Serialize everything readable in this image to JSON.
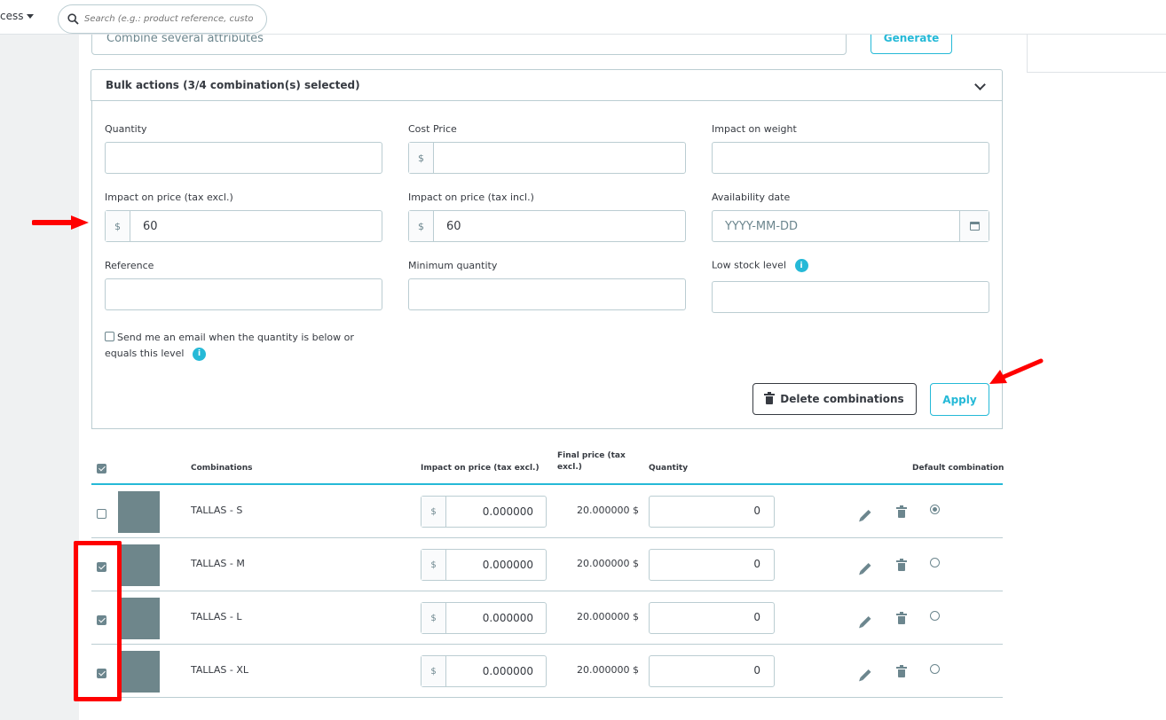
{
  "topbar": {
    "quick_access_label": "cess",
    "search_placeholder": "Search (e.g.: product reference, custon"
  },
  "generator": {
    "combine_placeholder": "Combine several attributes",
    "generate_label": "Generate"
  },
  "bulk": {
    "title": "Bulk actions (3/4 combination(s) selected)",
    "currency": "$",
    "fields": {
      "quantity_label": "Quantity",
      "cost_price_label": "Cost Price",
      "impact_weight_label": "Impact on weight",
      "impact_price_excl_label": "Impact on price (tax excl.)",
      "impact_price_excl_value": "60",
      "impact_price_incl_label": "Impact on price (tax incl.)",
      "impact_price_incl_value": "60",
      "availability_label": "Availability date",
      "availability_placeholder": "YYYY-MM-DD",
      "reference_label": "Reference",
      "min_qty_label": "Minimum quantity",
      "low_stock_label": "Low stock level"
    },
    "email_text_line1": "Send me an email when the quantity is below or",
    "email_text_line2": "equals this level",
    "info_glyph": "i",
    "delete_label": "Delete combinations",
    "apply_label": "Apply"
  },
  "table": {
    "headers": {
      "combinations": "Combinations",
      "impact": "Impact on price (tax excl.)",
      "final_line1": "Final price (tax",
      "final_line2": "excl.)",
      "quantity": "Quantity",
      "default": "Default combination"
    },
    "rows": [
      {
        "name": "TALLAS - S",
        "checked": false,
        "impact": "0.000000",
        "final": "20.000000 $",
        "quantity": "0",
        "default": true
      },
      {
        "name": "TALLAS - M",
        "checked": true,
        "impact": "0.000000",
        "final": "20.000000 $",
        "quantity": "0",
        "default": false
      },
      {
        "name": "TALLAS - L",
        "checked": true,
        "impact": "0.000000",
        "final": "20.000000 $",
        "quantity": "0",
        "default": false
      },
      {
        "name": "TALLAS - XL",
        "checked": true,
        "impact": "0.000000",
        "final": "20.000000 $",
        "quantity": "0",
        "default": false
      }
    ]
  },
  "colors": {
    "accent": "#25b9d7",
    "annotation": "#ff0000",
    "thumbnail": "#6e868b"
  }
}
